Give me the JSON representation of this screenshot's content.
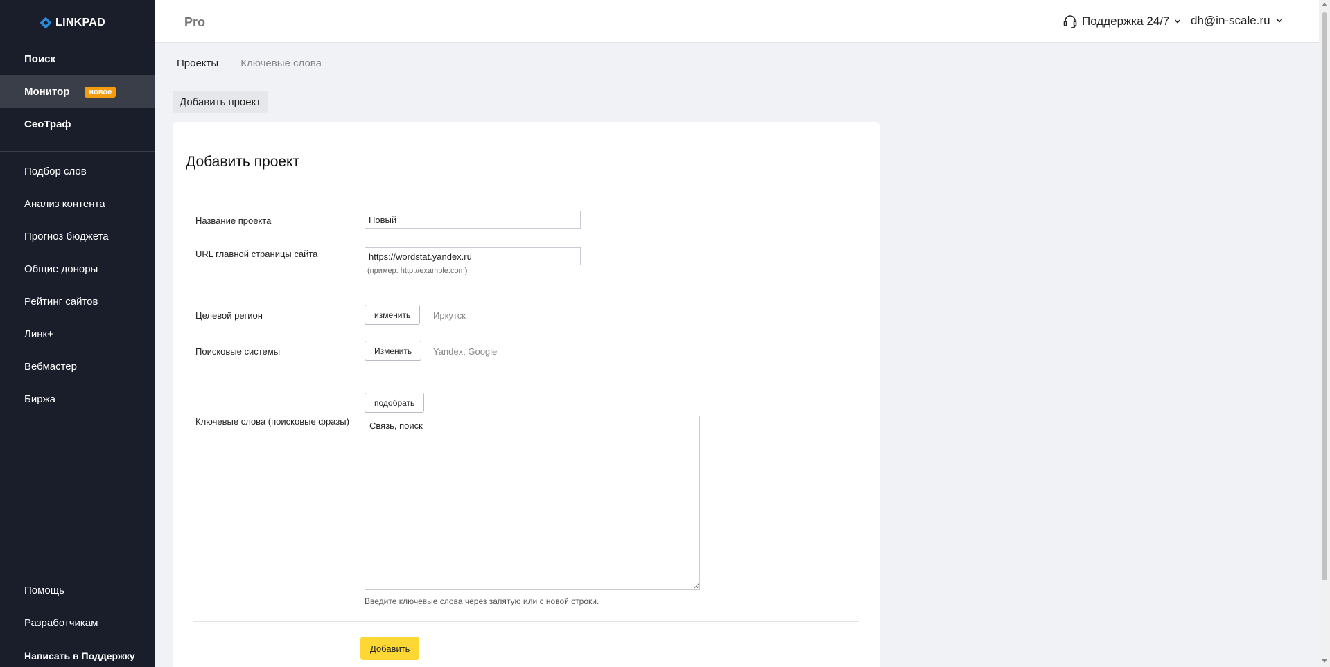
{
  "brand": {
    "name": "LINKPAD"
  },
  "sidebar": {
    "main": [
      {
        "label": "Поиск"
      },
      {
        "label": "Монитор",
        "badge": "новое",
        "active": true
      },
      {
        "label": "СеоТраф"
      }
    ],
    "tools": [
      {
        "label": "Подбор слов"
      },
      {
        "label": "Анализ контента"
      },
      {
        "label": "Прогноз бюджета"
      },
      {
        "label": "Общие доноры"
      },
      {
        "label": "Рейтинг сайтов"
      },
      {
        "label": "Линк+"
      },
      {
        "label": "Вебмастер"
      },
      {
        "label": "Биржа"
      }
    ],
    "bottom": [
      {
        "label": "Помощь"
      },
      {
        "label": "Разработчикам"
      },
      {
        "label": "Написать в Поддержку"
      }
    ]
  },
  "header": {
    "plan": "Pro",
    "support": "Поддержка 24/7",
    "user": "dh@in-scale.ru"
  },
  "tabs": [
    {
      "label": "Проекты",
      "active": true
    },
    {
      "label": "Ключевые слова"
    }
  ],
  "add_project_button": "Добавить проект",
  "form": {
    "title": "Добавить проект",
    "project_name": {
      "label": "Название проекта",
      "value": "Новый"
    },
    "url": {
      "label": "URL главной страницы сайта",
      "value": "https://wordstat.yandex.ru",
      "hint": "(пример: http://example.com)"
    },
    "region": {
      "label": "Целевой регион",
      "button": "изменить",
      "value": "Иркутск"
    },
    "engines": {
      "label": "Поисковые системы",
      "button": "Изменить",
      "value": "Yandex, Google"
    },
    "keywords": {
      "label": "Ключевые слова (поисковые фразы)",
      "button": "подобрать",
      "value": "Связь, поиск",
      "hint": "Введите ключевые слова через запятую или с новой строки."
    },
    "submit": "Добавить"
  },
  "colors": {
    "sidebar_bg": "#1a1e2a",
    "accent_yellow": "#fdd835",
    "badge_orange": "#f39c12",
    "logo_blue": "#2e8ad8"
  }
}
